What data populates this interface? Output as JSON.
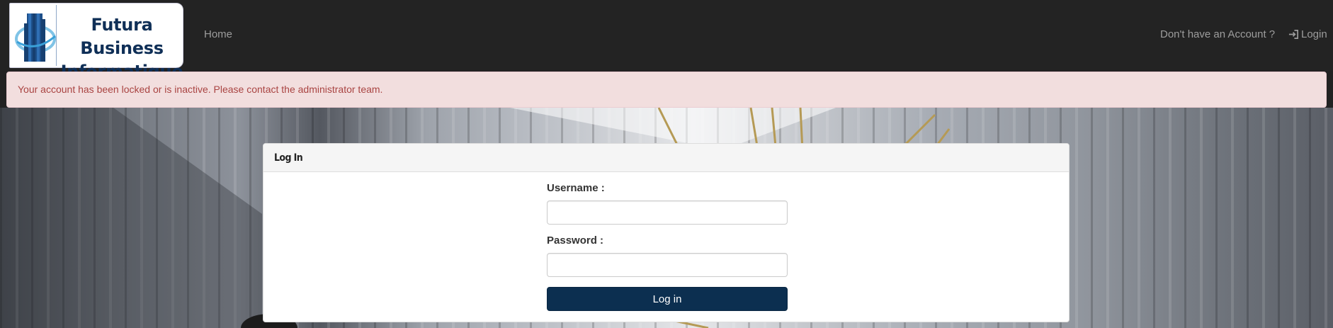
{
  "brand": {
    "line1": "Futura Business",
    "line2": "Informatique"
  },
  "nav": {
    "home": "Home",
    "signup": "Don't have an Account ?",
    "login": "Login",
    "login_icon": "sign-in-icon"
  },
  "alert": {
    "message": "Your account has been locked or is inactive. Please contact the administrator team."
  },
  "login_panel": {
    "heading": "Log In",
    "username_label": "Username :",
    "username_value": "",
    "password_label": "Password :",
    "password_value": "",
    "submit_label": "Log in"
  },
  "colors": {
    "navbar": "#232323",
    "brand_text": "#0f2f57",
    "alert_bg": "#f2dede",
    "alert_text": "#a94442",
    "button_bg": "#0c2f50"
  }
}
